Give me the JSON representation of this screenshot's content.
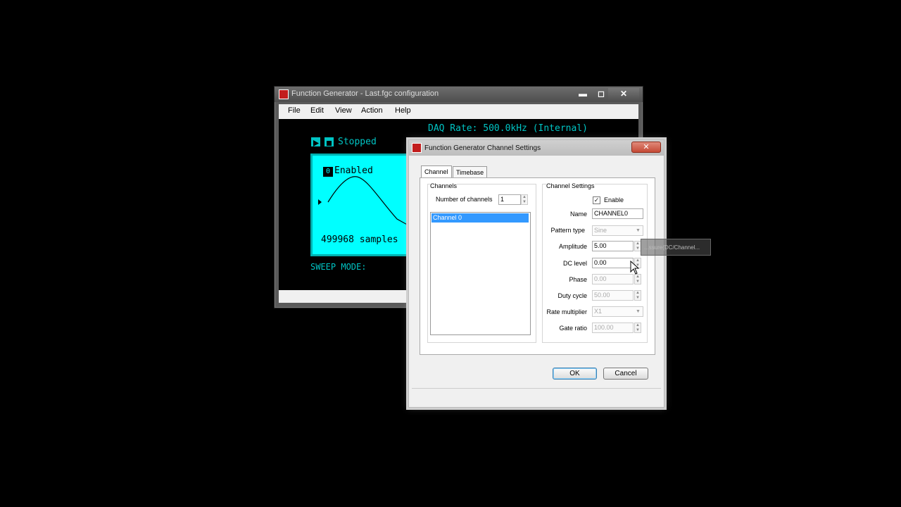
{
  "main_window": {
    "title": "Function Generator - Last.fgc configuration",
    "menu": [
      "File",
      "Edit",
      "View",
      "Action",
      "Help"
    ],
    "daq_rate": "DAQ Rate: 500.0kHz (Internal)",
    "run_state": "Stopped",
    "channel_badge": "0",
    "channel_state": "Enabled",
    "samples": "499968 samples",
    "sweep_mode": "SWEEP MODE:",
    "controls": {
      "minimize": "▬",
      "maximize": "◻",
      "close": "✕"
    }
  },
  "dialog": {
    "title": "Function Generator Channel Settings",
    "close": "✕",
    "tabs": [
      "Channel",
      "Timebase"
    ],
    "channels_group": {
      "title": "Channels",
      "num_label": "Number of channels",
      "num_value": "1",
      "list": [
        "Channel 0"
      ]
    },
    "settings_group": {
      "title": "Channel Settings",
      "enable_label": "Enable",
      "enable_check": "✓",
      "name_label": "Name",
      "name_value": "CHANNEL0",
      "pattern_label": "Pattern type",
      "pattern_value": "Sine",
      "amplitude_label": "Amplitude",
      "amplitude_value": "5.00",
      "dc_label": "DC level",
      "dc_value": "0.00",
      "phase_label": "Phase",
      "phase_value": "0.00",
      "duty_label": "Duty cycle",
      "duty_value": "50.00",
      "rate_label": "Rate multiplier",
      "rate_value": "X1",
      "gate_label": "Gate ratio",
      "gate_value": "100.00"
    },
    "ok": "OK",
    "cancel": "Cancel"
  },
  "tooltip": "...ssure(DC/Channel..."
}
